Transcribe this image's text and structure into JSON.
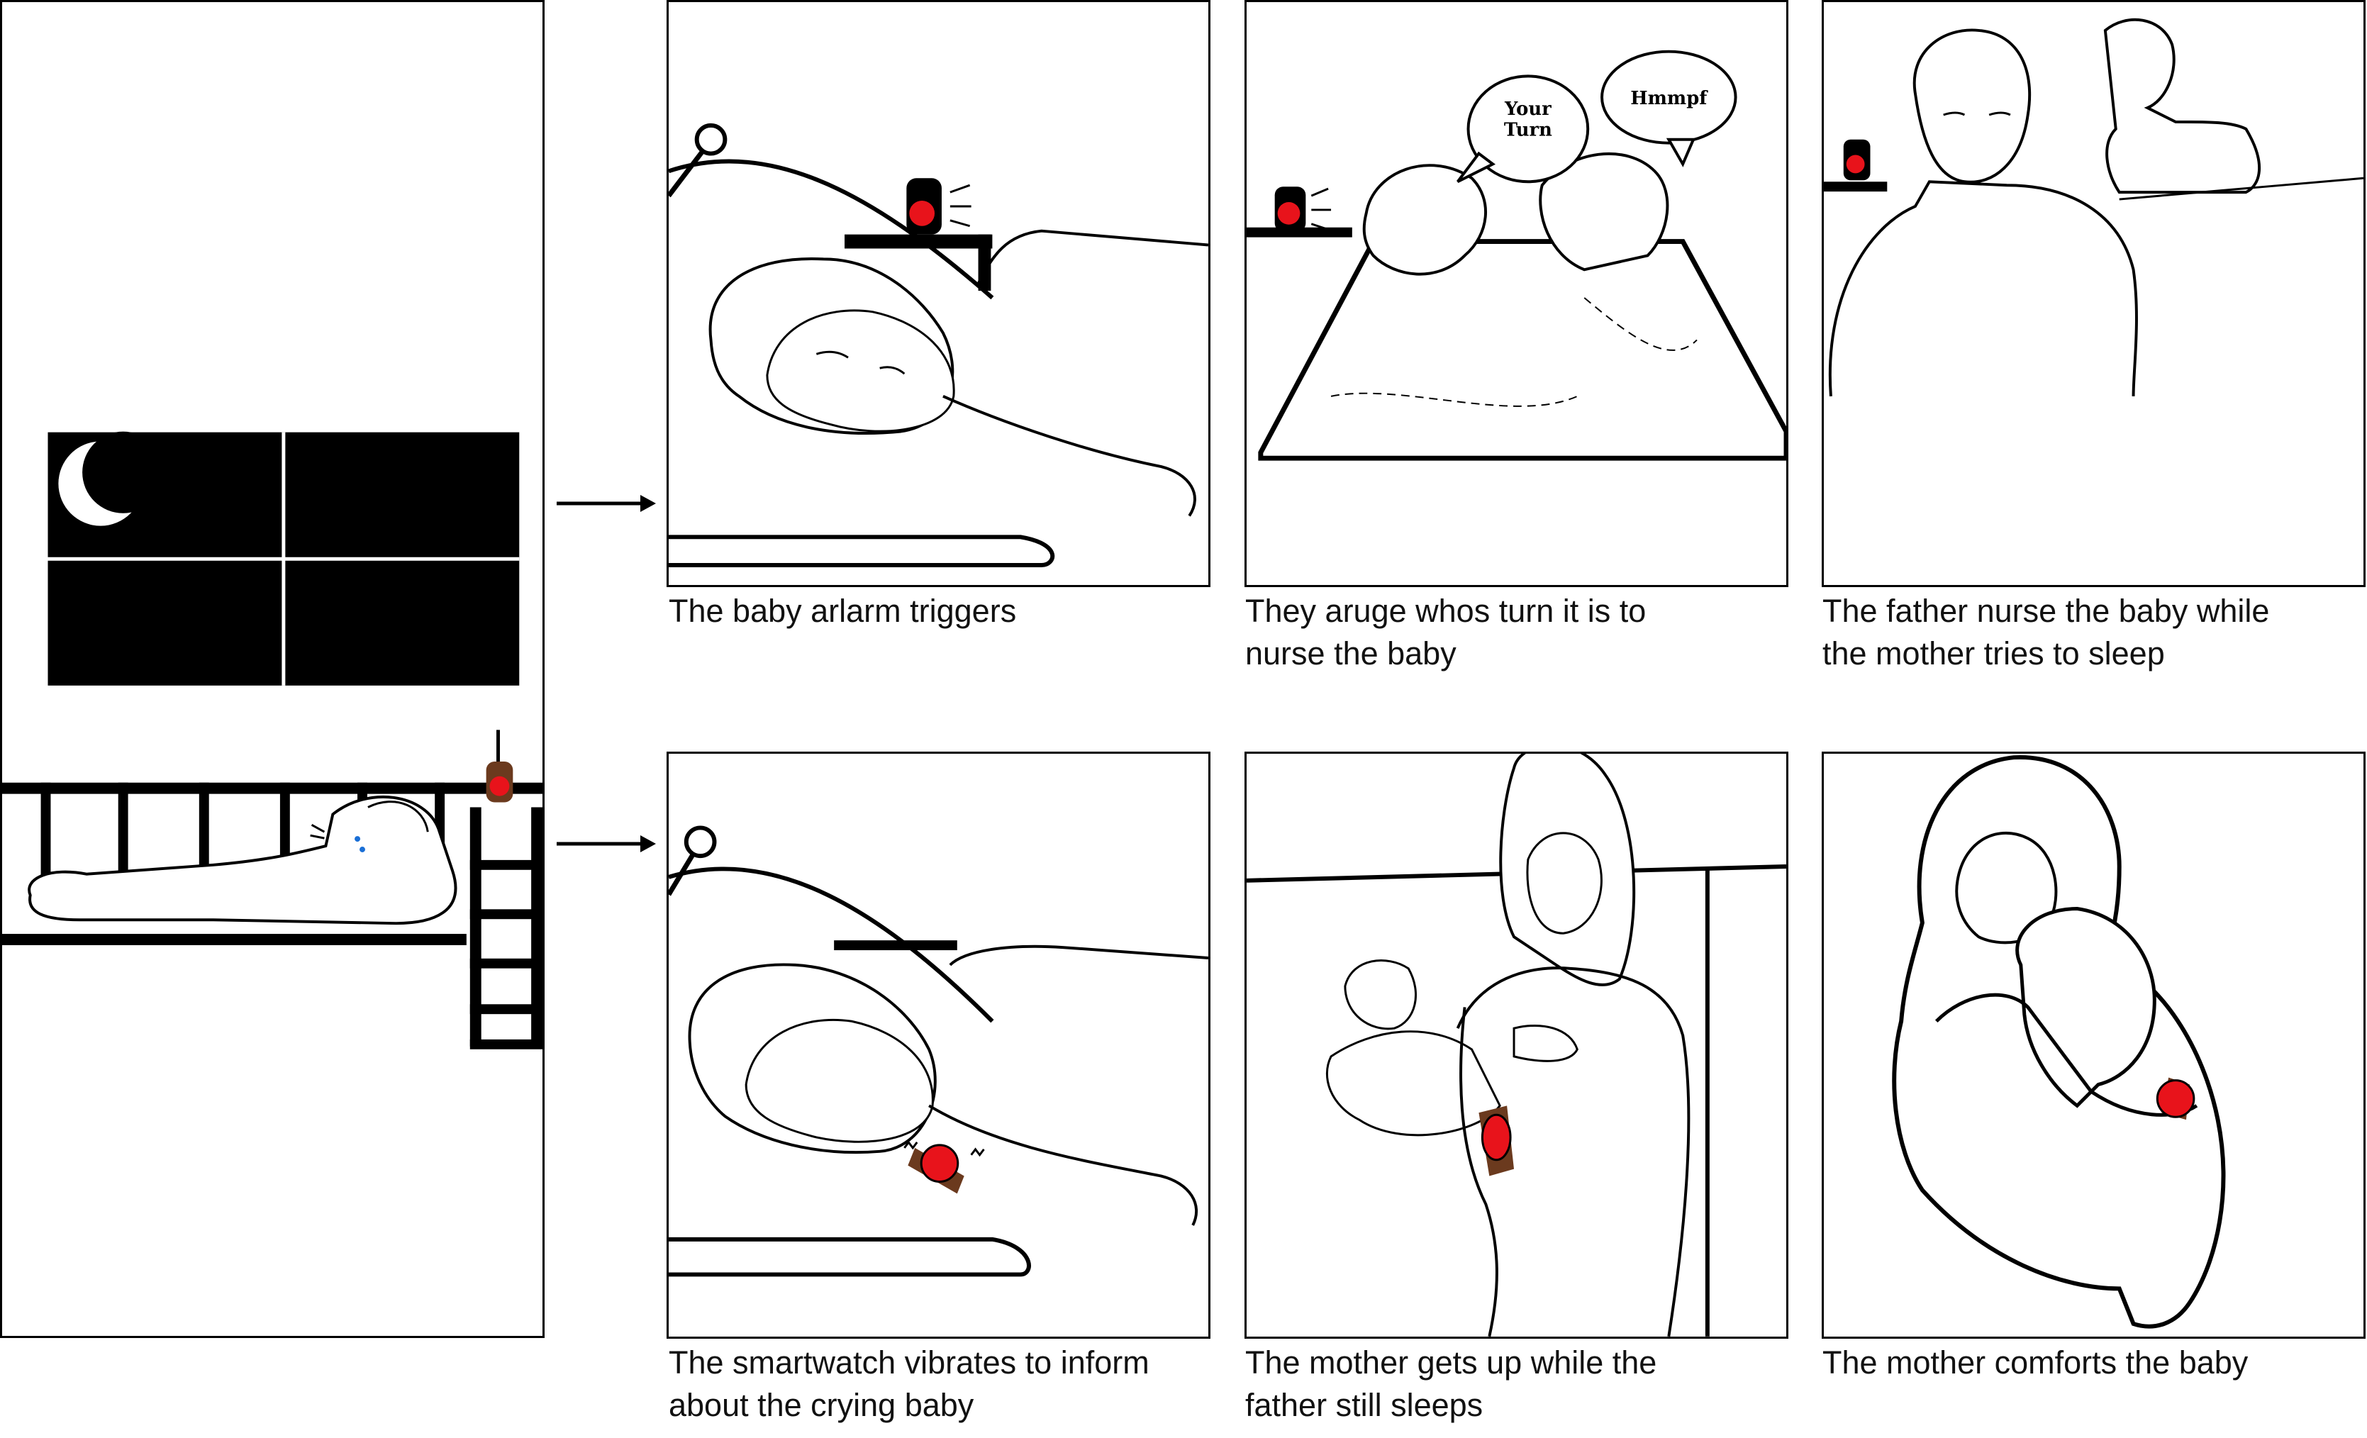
{
  "colors": {
    "ink": "#000000",
    "alarm_red": "#e8131b",
    "watch_band": "#6b3a1e",
    "tear_blue": "#1a6fd6",
    "night_window": "#000000"
  },
  "panels": [
    {
      "caption": "The baby arlarm triggers"
    },
    {
      "caption": "They aruge whos turn it is to\nnurse the baby",
      "bubbles": [
        "Your\nTurn",
        "Hmmpf"
      ]
    },
    {
      "caption": "The father nurse the baby while\nthe mother tries to sleep"
    },
    {
      "caption": "The smartwatch vibrates to inform\nabout the crying baby"
    },
    {
      "caption": "The mother gets up while the\nfather still sleeps"
    },
    {
      "caption": "The mother comforts the baby"
    }
  ],
  "icons": [
    "moon-icon",
    "baby-monitor-icon",
    "smartwatch-icon",
    "arrow-right-icon"
  ]
}
